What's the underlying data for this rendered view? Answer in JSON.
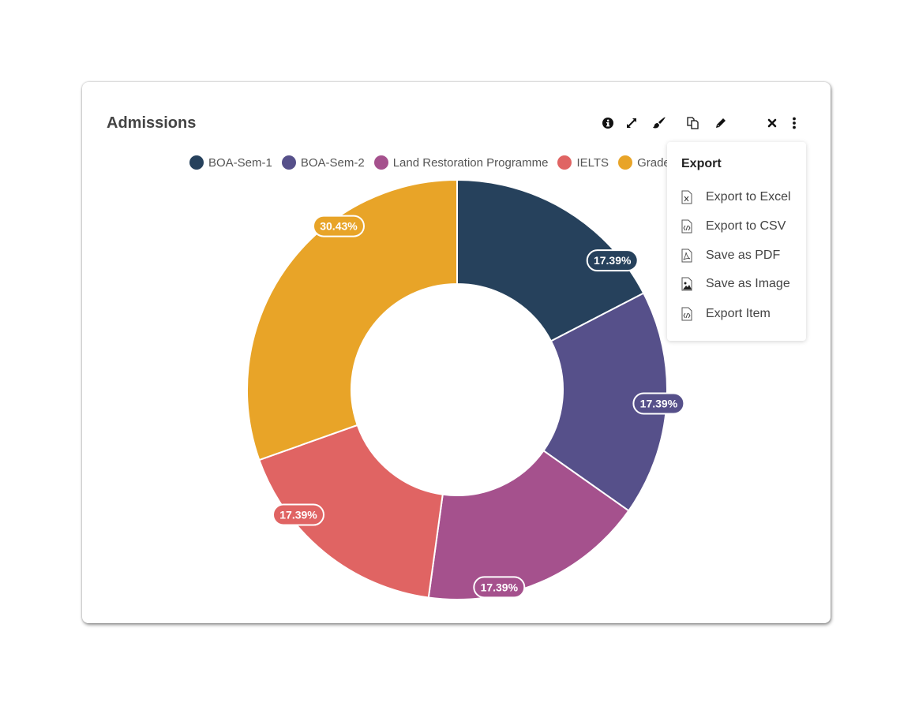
{
  "widget": {
    "title": "Admissions",
    "toolbar": {
      "icons": [
        "info-icon",
        "expand-icon",
        "brush-icon",
        "copy-icon",
        "edit-icon",
        "close-icon",
        "more-vertical-icon"
      ]
    }
  },
  "export_menu": {
    "title": "Export",
    "items": [
      {
        "label": "Export to Excel",
        "icon": "excel-file-icon"
      },
      {
        "label": "Export to CSV",
        "icon": "csv-file-icon"
      },
      {
        "label": "Save as PDF",
        "icon": "pdf-file-icon"
      },
      {
        "label": "Save as Image",
        "icon": "image-file-icon"
      },
      {
        "label": "Export Item",
        "icon": "code-file-icon"
      }
    ]
  },
  "chart_data": {
    "type": "pie",
    "subtype": "donut",
    "title": "Admissions",
    "legend_position": "top",
    "categories": [
      "BOA-Sem-1",
      "BOA-Sem-2",
      "Land Restoration Programme",
      "IELTS",
      "Grade"
    ],
    "values": [
      4,
      4,
      4,
      4,
      7
    ],
    "percent_labels": [
      "17.39%",
      "17.39%",
      "17.39%",
      "17.39%",
      "30.43%"
    ],
    "colors": [
      "#26415c",
      "#56508a",
      "#a5518d",
      "#e06463",
      "#e8a428"
    ]
  }
}
